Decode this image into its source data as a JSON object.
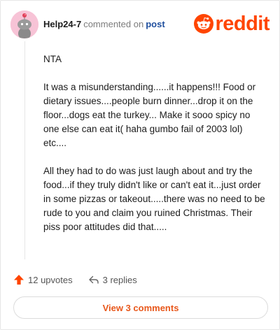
{
  "header": {
    "username": "Help24-7",
    "action_text": "commented on",
    "post_link": "post",
    "logo_text": "reddit"
  },
  "comment": {
    "paragraphs": [
      "NTA",
      "It was a misunderstanding......it happens!!! Food or dietary issues....people burn dinner...drop it on the floor...dogs eat the turkey... Make it sooo spicy no one else can eat it( haha gumbo fail of 2003 lol) etc....",
      "All they had to do was just laugh about and try the food...if they truly didn't like or can't eat it...just order in some pizzas or takeout.....there was no need to be rude to you and claim you ruined Christmas. Their piss poor attitudes did that....."
    ]
  },
  "actions": {
    "upvotes": "12 upvotes",
    "replies": "3 replies"
  },
  "footer": {
    "view_button": "View 3 comments"
  },
  "colors": {
    "accent": "#ff4500",
    "button_text": "#e8581c",
    "link": "#1f4f9e",
    "avatar_bg": "#f7c3d6"
  }
}
